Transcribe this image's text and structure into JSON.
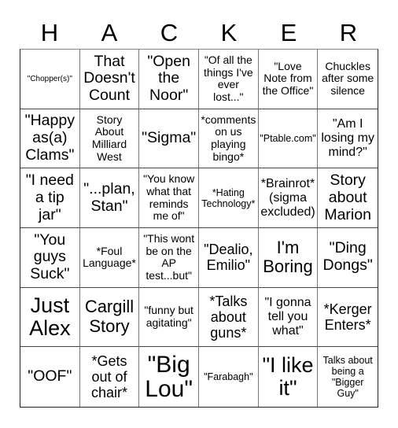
{
  "header": {
    "letters": [
      "H",
      "A",
      "C",
      "K",
      "E",
      "R"
    ]
  },
  "board": {
    "rows": [
      [
        "\"Chopper(s)\"",
        "That Doesn't Count",
        "\"Open the Noor\"",
        "\"Of all the things I've ever lost...\"",
        "\"Love Note from the Office\"",
        "Chuckles after some silence"
      ],
      [
        "\"Happy as(a) Clams\"",
        "Story About Milliard West",
        "\"Sigma\"",
        "*comments on us playing bingo*",
        "\"Ptable.com\"",
        "\"Am I losing my mind?\""
      ],
      [
        "\"I need a tip jar\"",
        "\"...plan, Stan\"",
        "\"You know what that reminds me of\"",
        "*Hating Technology*",
        "*Brainrot* (sigma excluded)",
        "Story about Marion"
      ],
      [
        "\"You guys Suck\"",
        "*Foul Language*",
        "\"This wont be on the AP test...but\"",
        "\"Dealio, Emilio\"",
        "I'm Boring",
        "\"Ding Dongs\""
      ],
      [
        "Just Alex",
        "Cargill Story",
        "\"funny but agitating\"",
        "*Talks about guns*",
        "\"I gonna tell you what\"",
        "*Kerger Enters*"
      ],
      [
        "\"OOF\"",
        "*Gets out of chair*",
        "\"Big Lou\"",
        "\"Farabagh\"",
        "\"I like it\"",
        "Talks about being a \"Bigger Guy\""
      ]
    ]
  }
}
